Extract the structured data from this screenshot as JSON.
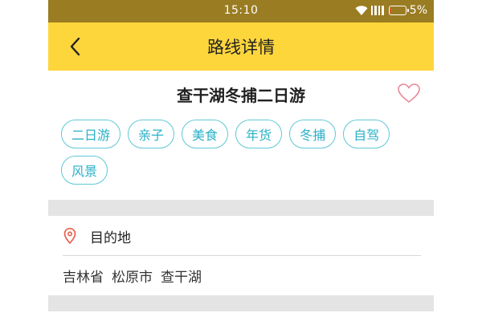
{
  "status_bar": {
    "time": "15:10",
    "battery_text": "5%",
    "battery_level": 0.05,
    "battery_color": "#ff4a3a"
  },
  "nav_bar": {
    "title": "路线详情",
    "back_icon": "chevron-left-icon",
    "background_color": "#fdd63c"
  },
  "route": {
    "title": "查干湖冬捕二日游",
    "favorite_icon": "heart-outline-icon",
    "tags": [
      "二日游",
      "亲子",
      "美食",
      "年货",
      "冬捕",
      "自驾",
      "风景"
    ],
    "tag_color": "#2ab0c8"
  },
  "destination": {
    "icon": "location-pin-icon",
    "icon_color": "#e8604c",
    "label": "目的地",
    "address": [
      "吉林省",
      "松原市",
      "查干湖"
    ]
  }
}
